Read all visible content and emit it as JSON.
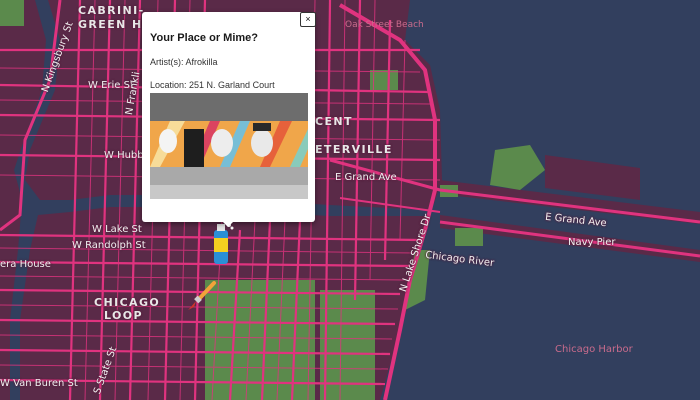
{
  "popup": {
    "title": "Your Place or Mime?",
    "artist": "Artist(s): Afrokilla",
    "location": "Location: 251 N. Garland Court",
    "close_label": "×"
  },
  "labels": {
    "cabrini": "CABRINI-",
    "green_homes": "GREEN HOMES",
    "oak_street": "Oak Street Beach",
    "w_erie": "W Erie St",
    "n_kingsbury": "N Kingsbury St",
    "n_franklin": "N Frankli",
    "w_hubbard": "W Hubb",
    "cent": "CENT",
    "streeterville": "ETERVILLE",
    "e_grand_1": "E Grand Ave",
    "e_grand_2": "E Grand Ave",
    "navy_pier": "Navy Pier",
    "lake_shore": "N Lake Shore Dr",
    "chicago_river": "Chicago River",
    "w_lake": "W Lake St",
    "w_randolph": "W Randolph St",
    "opera_house": "era House",
    "chicago": "CHICAGO",
    "loop": "LOOP",
    "van_buren": "W Van Buren St",
    "state_st": "S State St",
    "chicago_harbor": "Chicago Harbor"
  },
  "colors": {
    "water": "#323f5e",
    "land": "#5a2a48",
    "road": "#e0337f",
    "park": "#5b8a4c"
  },
  "markers": [
    {
      "icon": "spray-can-icon"
    },
    {
      "icon": "paintbrush-icon"
    }
  ]
}
